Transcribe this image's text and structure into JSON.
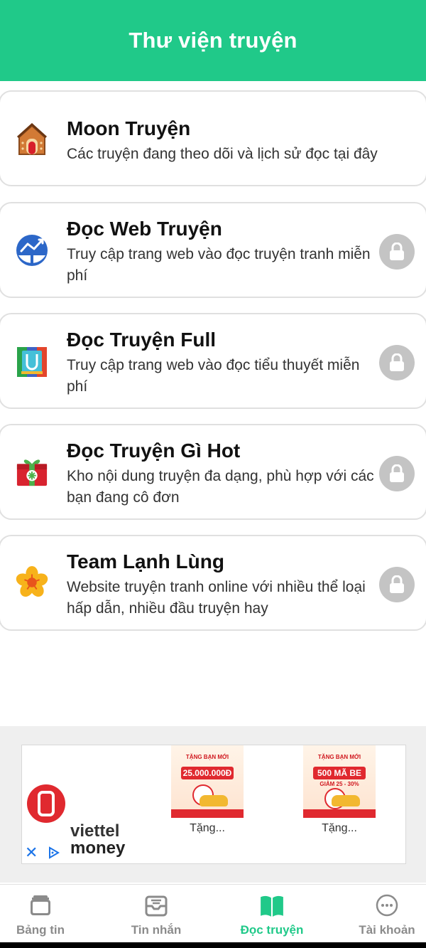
{
  "header": {
    "title": "Thư viện truyện"
  },
  "cards": [
    {
      "title": "Moon Truyện",
      "desc": "Các truyện đang theo dõi và lịch sử đọc tại đây",
      "icon": "house-icon",
      "locked": false
    },
    {
      "title": "Đọc Web Truyện",
      "desc": "Truy cập trang web vào đọc truyện tranh miễn phí",
      "icon": "chart-circle-icon",
      "locked": true
    },
    {
      "title": "Đọc Truyện Full",
      "desc": "Truy cập trang web vào đọc tiểu thuyết miễn phí",
      "icon": "u-book-icon",
      "locked": true
    },
    {
      "title": "Đọc Truyện Gì Hot",
      "desc": "Kho nội dung truyện đa dạng, phù hợp với các bạn đang cô đơn",
      "icon": "gift-box-icon",
      "locked": true
    },
    {
      "title": "Team Lạnh Lùng",
      "desc": "Website truyện tranh online với nhiều thể loại hấp dẫn, nhiều đầu truyện hay",
      "icon": "flower-icon",
      "locked": true
    }
  ],
  "ad": {
    "brand_line1": "viettel",
    "brand_line2": "money",
    "promos": [
      {
        "headline": "TẶNG BẠN MỚI",
        "amount": "25.000.000Đ",
        "label": "Tặng..."
      },
      {
        "headline": "TẶNG BẠN MỚI",
        "amount": "500 MÃ BE",
        "sub": "GIẢM 25 - 30%",
        "label": "Tặng..."
      }
    ]
  },
  "bottom_nav": [
    {
      "label": "Bảng tin",
      "icon": "inbox-tray-icon",
      "active": false
    },
    {
      "label": "Tin nhắn",
      "icon": "message-tray-icon",
      "active": false
    },
    {
      "label": "Đọc truyện",
      "icon": "open-book-icon",
      "active": true
    },
    {
      "label": "Tài khoản",
      "icon": "more-circle-icon",
      "active": false
    }
  ],
  "colors": {
    "accent": "#20c989",
    "lock_bg": "#c4c4c4",
    "ad_red": "#e0292f"
  }
}
